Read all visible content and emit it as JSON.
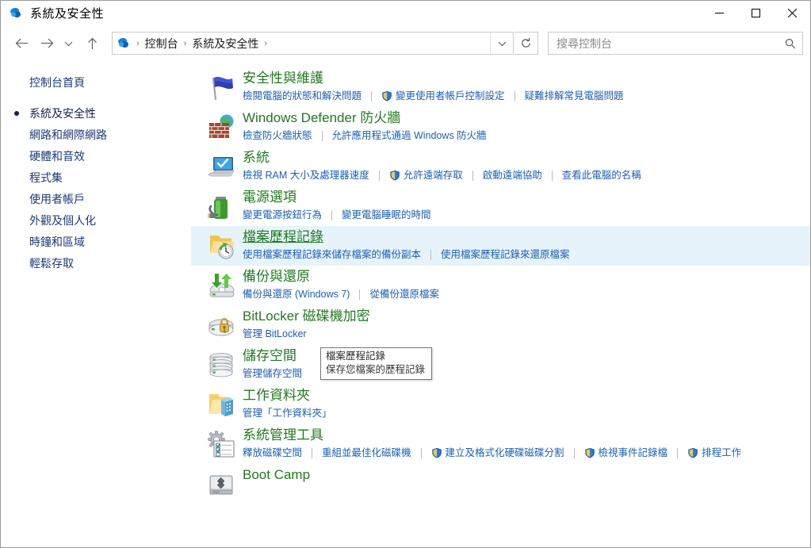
{
  "window": {
    "title": "系統及安全性",
    "icon": "control-panel-icon",
    "controls": {
      "minimize": "–",
      "maximize": "□",
      "close": "✕"
    }
  },
  "toolbar": {
    "back": "back-arrow-icon",
    "forward": "forward-arrow-icon",
    "recent": "recent-locations-chevron-icon",
    "up": "up-arrow-icon",
    "refresh": "refresh-icon",
    "address_dropdown": "chevron-down-icon"
  },
  "breadcrumb": {
    "icon": "control-panel-icon",
    "items": [
      "控制台",
      "系統及安全性"
    ],
    "trailing_separator": "›"
  },
  "search": {
    "placeholder": "搜尋控制台",
    "value": "",
    "icon": "search-icon"
  },
  "sidebar": {
    "items": [
      {
        "label": "控制台首頁",
        "current": false,
        "home": true
      },
      {
        "label": "系統及安全性",
        "current": true,
        "home": false
      },
      {
        "label": "網路和網際網路",
        "current": false,
        "home": false
      },
      {
        "label": "硬體和音效",
        "current": false,
        "home": false
      },
      {
        "label": "程式集",
        "current": false,
        "home": false
      },
      {
        "label": "使用者帳戶",
        "current": false,
        "home": false
      },
      {
        "label": "外觀及個人化",
        "current": false,
        "home": false
      },
      {
        "label": "時鐘和區域",
        "current": false,
        "home": false
      },
      {
        "label": "輕鬆存取",
        "current": false,
        "home": false
      }
    ]
  },
  "categories": [
    {
      "icon": "flag-icon",
      "title": "安全性與維護",
      "highlight": false,
      "links": [
        {
          "label": "檢閱電腦的狀態和解決問題",
          "shield": false
        },
        {
          "label": "變更使用者帳戶控制設定",
          "shield": true
        },
        {
          "label": "疑難排解常見電腦問題",
          "shield": false
        }
      ]
    },
    {
      "icon": "firewall-icon",
      "title": "Windows Defender 防火牆",
      "highlight": false,
      "links": [
        {
          "label": "檢查防火牆狀態",
          "shield": false
        },
        {
          "label": "允許應用程式通過 Windows 防火牆",
          "shield": false
        }
      ]
    },
    {
      "icon": "computer-icon",
      "title": "系統",
      "highlight": false,
      "links": [
        {
          "label": "檢視 RAM 大小及處理器速度",
          "shield": false
        },
        {
          "label": "允許遠端存取",
          "shield": true
        },
        {
          "label": "啟動遠端協助",
          "shield": false
        },
        {
          "label": "查看此電腦的名稱",
          "shield": false
        }
      ]
    },
    {
      "icon": "battery-icon",
      "title": "電源選項",
      "highlight": false,
      "links": [
        {
          "label": "變更電源按鈕行為",
          "shield": false
        },
        {
          "label": "變更電腦睡眠的時間",
          "shield": false
        }
      ]
    },
    {
      "icon": "file-history-icon",
      "title": "檔案歷程記錄",
      "highlight": true,
      "links": [
        {
          "label": "使用檔案歷程記錄來儲存檔案的備份副本",
          "shield": false
        },
        {
          "label": "使用檔案歷程記錄來還原檔案",
          "shield": false
        }
      ]
    },
    {
      "icon": "backup-restore-icon",
      "title": "備份與還原",
      "highlight": false,
      "links": [
        {
          "label": "備份與還原 (Windows 7)",
          "shield": false
        },
        {
          "label": "從備份還原檔案",
          "shield": false
        }
      ]
    },
    {
      "icon": "bitlocker-icon",
      "title": "BitLocker 磁碟機加密",
      "highlight": false,
      "links": [
        {
          "label": "管理 BitLocker",
          "shield": false
        }
      ]
    },
    {
      "icon": "storage-spaces-icon",
      "title": "儲存空間",
      "highlight": false,
      "links": [
        {
          "label": "管理儲存空間",
          "shield": false
        }
      ]
    },
    {
      "icon": "work-folders-icon",
      "title": "工作資料夾",
      "highlight": false,
      "links": [
        {
          "label": "管理「工作資料夾」",
          "shield": false
        }
      ]
    },
    {
      "icon": "admin-tools-icon",
      "title": "系統管理工具",
      "highlight": false,
      "links": [
        {
          "label": "釋放磁碟空間",
          "shield": false
        },
        {
          "label": "重組並最佳化磁碟機",
          "shield": false
        },
        {
          "label": "建立及格式化硬碟磁碟分割",
          "shield": true
        },
        {
          "label": "檢視事件記錄檔",
          "shield": true
        },
        {
          "label": "排程工作",
          "shield": true
        }
      ]
    },
    {
      "icon": "boot-camp-icon",
      "title": "Boot Camp",
      "highlight": false,
      "links": []
    }
  ],
  "tooltip": {
    "title": "檔案歷程記錄",
    "description": "保存您檔案的歷程記錄"
  },
  "colors": {
    "category_title": "#1f7a1f",
    "link": "#1d5fb5",
    "sidebar_link": "#1a3a7a",
    "highlight_bg": "#e7f3fb",
    "accent": "#0078d7"
  }
}
